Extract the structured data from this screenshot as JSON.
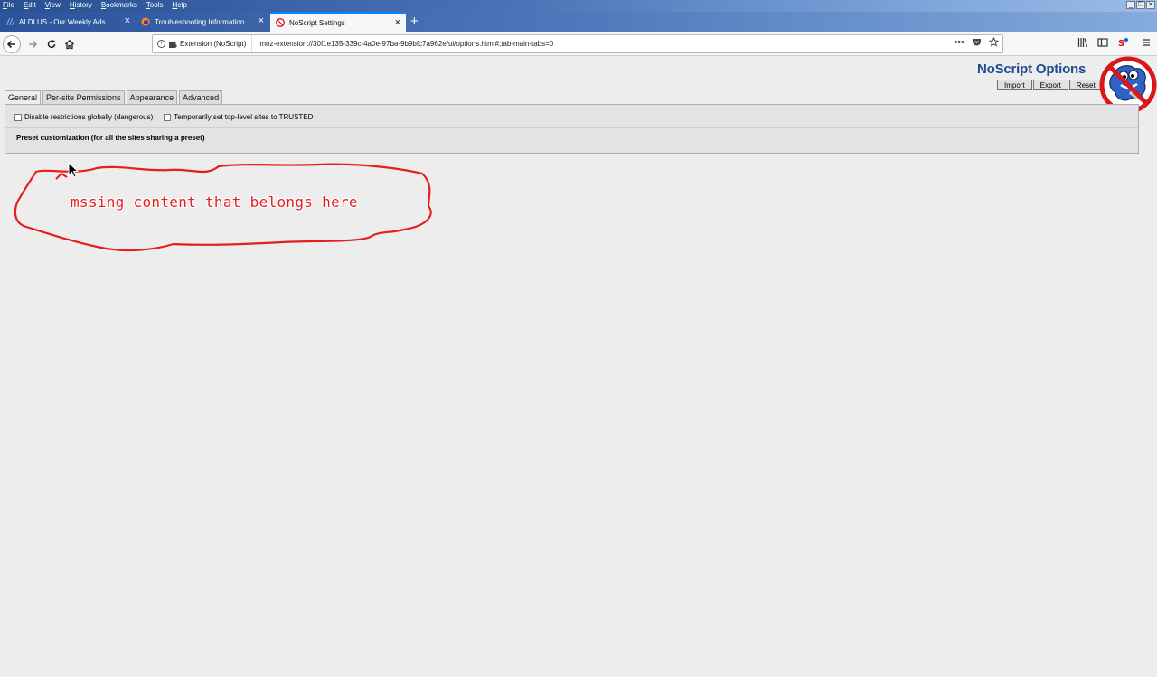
{
  "window": {
    "menu": [
      "File",
      "Edit",
      "View",
      "History",
      "Bookmarks",
      "Tools",
      "Help"
    ],
    "controls": [
      "_",
      "❐",
      "✕"
    ]
  },
  "tabs": [
    {
      "label": "ALDI US - Our Weekly Ads",
      "icon": "aldi-icon",
      "active": false
    },
    {
      "label": "Troubleshooting Information",
      "icon": "firefox-icon",
      "active": false
    },
    {
      "label": "NoScript Settings",
      "icon": "noscript-icon",
      "active": true
    }
  ],
  "nav": {
    "identity": "Extension (NoScript)",
    "url": "moz-extension://30f1e135-339c-4a0e-97ba-9b9bfc7a962e/ui/options.html#;tab-main-tabs=0",
    "more": "•••"
  },
  "page": {
    "title": "NoScript Options",
    "buttons": {
      "import": "Import",
      "export": "Export",
      "reset": "Reset"
    },
    "tabs": [
      "General",
      "Per-site Permissions",
      "Appearance",
      "Advanced"
    ],
    "active_tab": "General",
    "options": {
      "disable_global": "Disable restrictions globally (dangerous)",
      "temp_trusted": "Temporarily set top-level sites to TRUSTED"
    },
    "preset_heading": "Preset customization (for all the sites sharing a preset)"
  },
  "annotation": {
    "text": "mssing content that belongs here",
    "color": "#e51e1e"
  },
  "colors": {
    "accent": "#0a84ff",
    "title": "#1f4c8f"
  }
}
